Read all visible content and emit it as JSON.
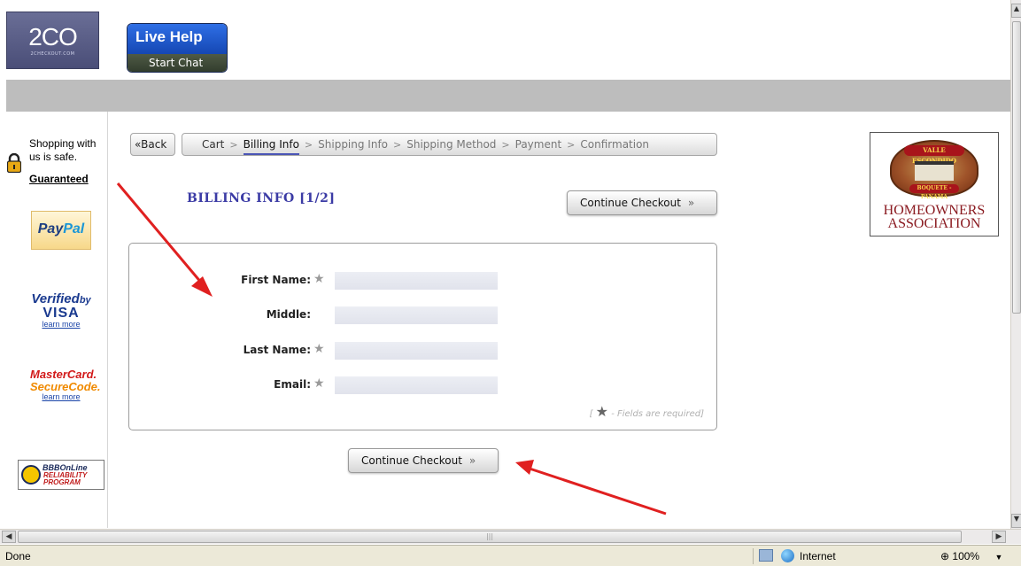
{
  "header": {
    "logo_main": "2CO",
    "logo_sub": "2CHECKOUT.COM",
    "live_help_title": "Live Help",
    "live_help_action": "Start Chat"
  },
  "sidebar": {
    "safe_text": "Shopping with us is safe.",
    "guaranteed": "Guaranteed",
    "paypal_1": "Pay",
    "paypal_2": "Pal",
    "vbv_1": "Verified",
    "vbv_by": "by",
    "vbv_2": "VISA",
    "vbv_learn": "learn more",
    "mc_1": "MasterCard.",
    "mc_2": "SecureCode.",
    "mc_learn": "learn more",
    "bbb_1": "BBBOnLine",
    "bbb_2": "RELIABILITY",
    "bbb_3": "PROGRAM"
  },
  "breadcrumb": {
    "back": "«Back",
    "steps": [
      "Cart",
      "Billing Info",
      "Shipping Info",
      "Shipping Method",
      "Payment",
      "Confirmation"
    ],
    "active_step": "Billing Info"
  },
  "form": {
    "title": "BILLING INFO [1/2]",
    "continue_label": "Continue Checkout",
    "fields": [
      {
        "label": "First Name:",
        "required": true,
        "value": ""
      },
      {
        "label": "Middle:",
        "required": false,
        "value": ""
      },
      {
        "label": "Last Name:",
        "required": true,
        "value": ""
      },
      {
        "label": "Email:",
        "required": true,
        "value": ""
      }
    ],
    "required_note_pre": "[ ",
    "required_note": " - Fields are required]"
  },
  "hoa": {
    "band_top": "VALLE ESCONDIDO",
    "band_bottom": "BOQUETE - PANAMA",
    "line1": "HOMEOWNERS",
    "line2": "ASSOCIATION"
  },
  "statusbar": {
    "status": "Done",
    "zone": "Internet",
    "zoom": "100%"
  },
  "colors": {
    "title_blue": "#3b3ba5",
    "arrow_red": "#e02020",
    "header_gray": "#bdbdbd"
  }
}
